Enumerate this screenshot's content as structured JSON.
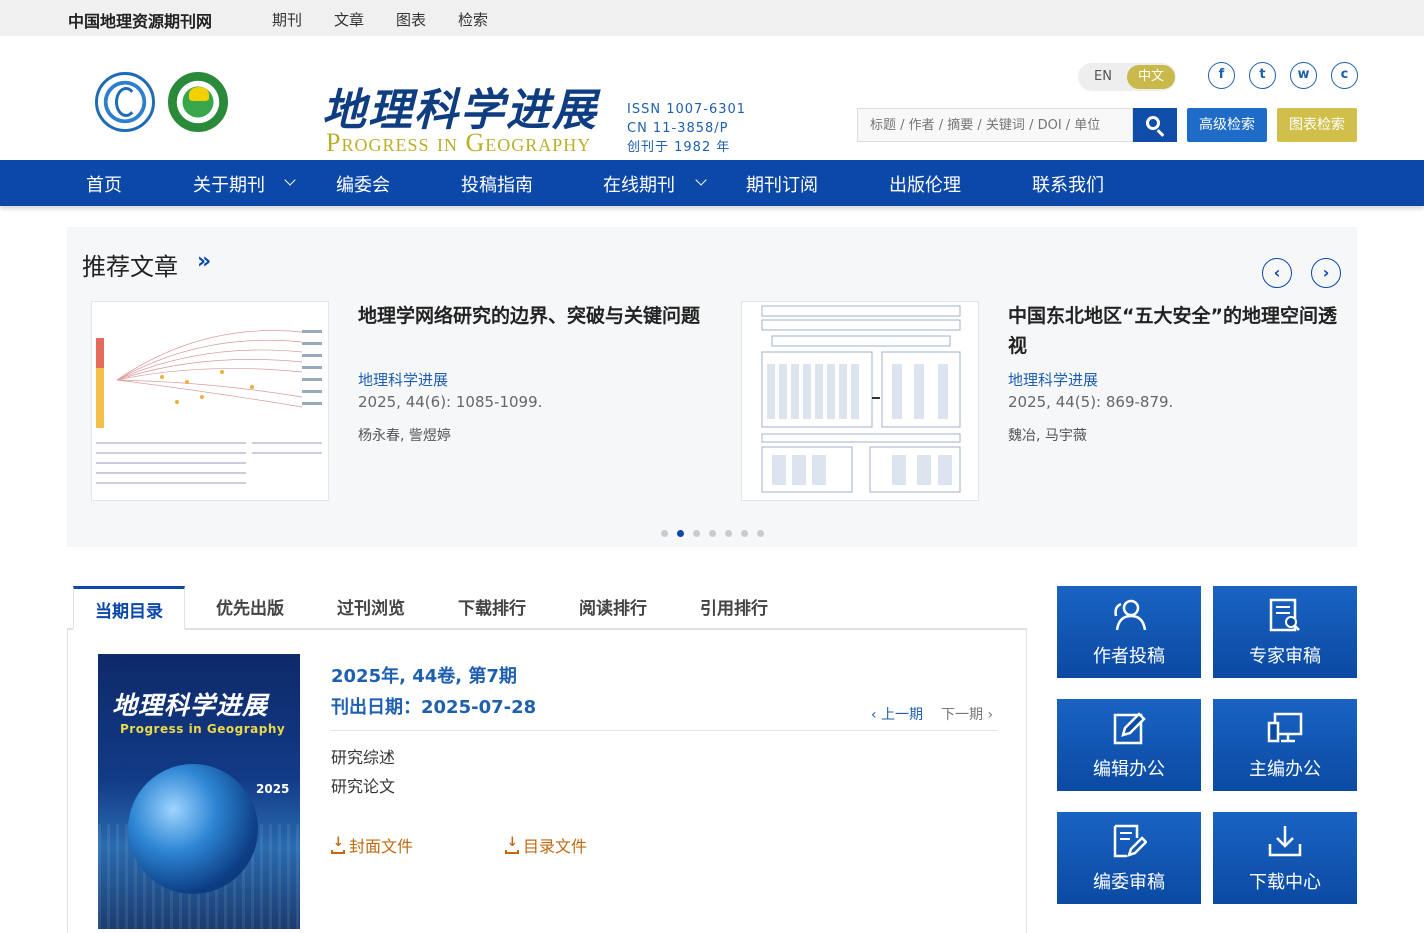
{
  "topbar": {
    "site_name": "中国地理资源期刊网",
    "links": [
      "期刊",
      "文章",
      "图表",
      "检索"
    ]
  },
  "header": {
    "brand_cn": "地理科学进展",
    "brand_en": "Progress in Geography",
    "issn": "ISSN 1007-6301",
    "cn": "CN 11-3858/P",
    "founded": "创刊于 1982 年",
    "lang_en": "EN",
    "lang_zh": "中文",
    "social": [
      "f",
      "t",
      "w",
      "c"
    ],
    "search_placeholder": "标题 / 作者 / 摘要 / 关键词 / DOI / 单位",
    "adv_search": "高级检索",
    "chart_search": "图表检索",
    "accent": "#0b48a8",
    "gold": "#d0bf4a"
  },
  "nav": {
    "items": [
      "首页",
      "关于期刊",
      "编委会",
      "投稿指南",
      "在线期刊",
      "期刊订阅",
      "出版伦理",
      "联系我们"
    ]
  },
  "recommended": {
    "title": "推荐文章",
    "more": "»",
    "prev": "‹",
    "next": "›",
    "articles": [
      {
        "title": "地理学网络研究的边界、突破与关键问题",
        "journal": "地理科学进展",
        "citation": "2025, 44(6): 1085-1099.",
        "authors": "杨永春, 訾煜婷"
      },
      {
        "title": "中国东北地区“五大安全”的地理空间透视",
        "journal": "地理科学进展",
        "citation": "2025, 44(5): 869-879.",
        "authors": "魏冶, 马宇薇"
      }
    ],
    "dots_total": 7,
    "dots_active": 2
  },
  "tabs": [
    "当期目录",
    "优先出版",
    "过刊浏览",
    "下载排行",
    "阅读排行",
    "引用排行"
  ],
  "issue": {
    "title": "2025年, 44卷, 第7期",
    "date": "刊出日期：2025-07-28",
    "prev": "上一期",
    "next": "下一期",
    "sections": [
      "研究综述",
      "研究论文"
    ],
    "cover_file": "封面文件",
    "toc_file": "目录文件",
    "cover": {
      "title": "地理科学进展",
      "en": "Progress in Geography",
      "year": "2025"
    }
  },
  "tiles": [
    "作者投稿",
    "专家审稿",
    "编辑办公",
    "主编办公",
    "编委审稿",
    "下载中心"
  ]
}
